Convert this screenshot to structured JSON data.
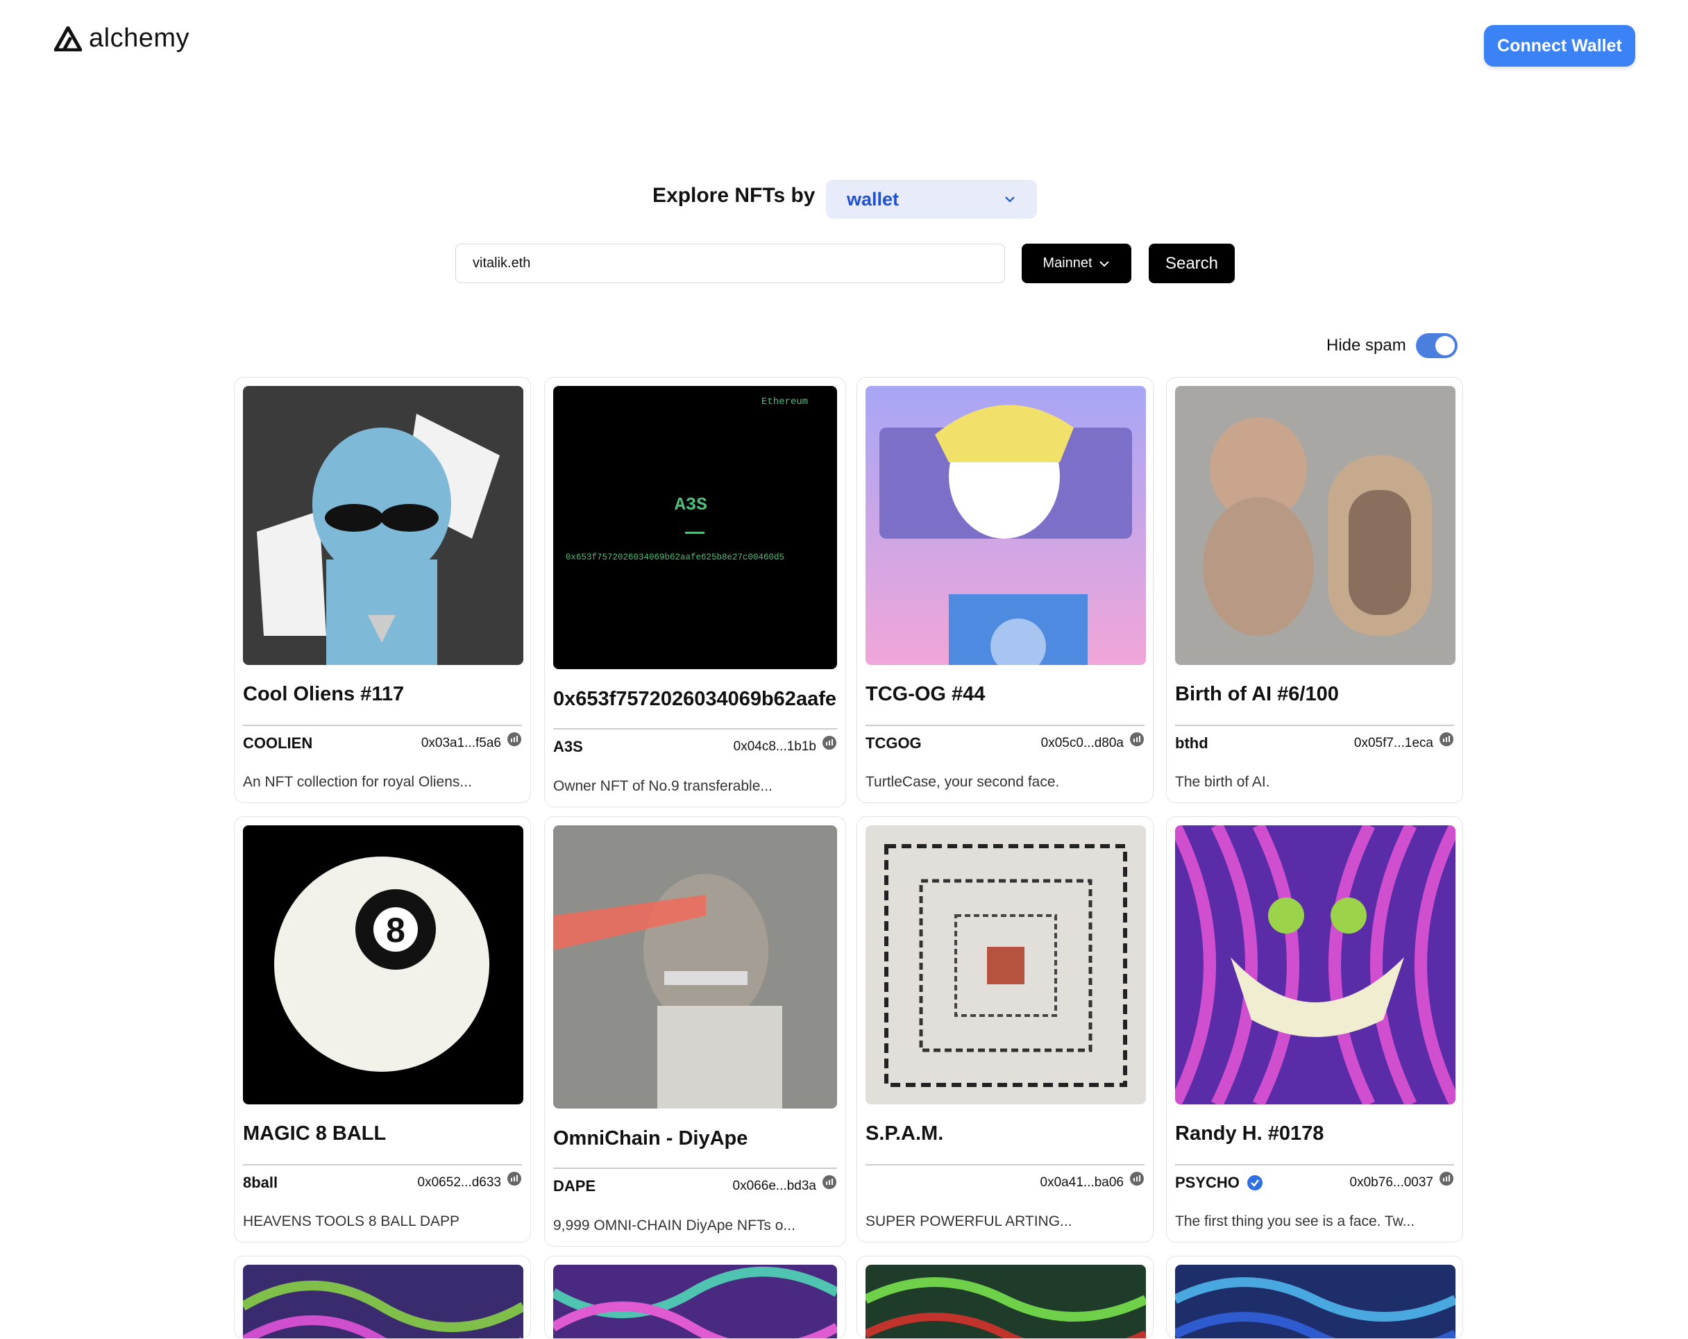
{
  "header": {
    "logo_text": "alchemy",
    "connect_label": "Connect Wallet"
  },
  "explore": {
    "label": "Explore NFTs by",
    "mode_selected": "wallet"
  },
  "search": {
    "value": "vitalik.eth",
    "network": "Mainnet",
    "button": "Search"
  },
  "filters": {
    "hide_spam_label": "Hide spam",
    "hide_spam_on": true
  },
  "nfts": [
    {
      "title": "Cool Oliens #117",
      "symbol": "COOLIEN",
      "address": "0x03a1...f5a6",
      "description": "An NFT collection for royal Oliens..."
    },
    {
      "title": "0x653f7572026034069b62aafe",
      "symbol": "A3S",
      "address": "0x04c8...1b1b",
      "description": "Owner NFT of No.9 transferable...",
      "image_chain_label": "Ethereum",
      "image_brand": "A3S",
      "image_address": "0x653f7572026034069b62aafe625b8e27c00460d5"
    },
    {
      "title": "TCG-OG #44",
      "symbol": "TCGOG",
      "address": "0x05c0...d80a",
      "description": "TurtleCase, your second face."
    },
    {
      "title": "Birth of AI #6/100",
      "symbol": "bthd",
      "address": "0x05f7...1eca",
      "description": "The birth of AI."
    },
    {
      "title": "MAGIC 8 BALL",
      "symbol": "8ball",
      "address": "0x0652...d633",
      "description": "HEAVENS TOOLS 8 BALL DAPP",
      "image_text": "8"
    },
    {
      "title": "OmniChain - DiyApe",
      "symbol": "DAPE",
      "address": "0x066e...bd3a",
      "description": "9,999 OMNI-CHAIN DiyApe NFTs o..."
    },
    {
      "title": "S.P.A.M.",
      "symbol": "",
      "address": "0x0a41...ba06",
      "description": "SUPER POWERFUL ARTING..."
    },
    {
      "title": "Randy H. #0178",
      "symbol": "PSYCHO",
      "address": "0x0b76...0037",
      "description": "The first thing you see is a face. Tw...",
      "verified": true
    }
  ],
  "icons": {
    "network_icon": "etherscan-icon",
    "verified_icon": "verified-badge-icon"
  }
}
